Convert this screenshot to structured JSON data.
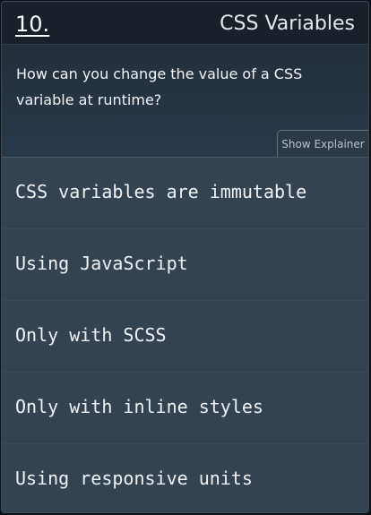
{
  "header": {
    "question_number": "10.",
    "topic": "CSS Variables"
  },
  "question": {
    "text": "How can you change the value of a CSS variable at runtime?"
  },
  "explainer": {
    "label": "Show Explainer"
  },
  "answers": [
    {
      "label": "CSS variables are immutable"
    },
    {
      "label": "Using JavaScript"
    },
    {
      "label": "Only with SCSS"
    },
    {
      "label": "Only with inline styles"
    },
    {
      "label": "Using responsive units"
    }
  ]
}
